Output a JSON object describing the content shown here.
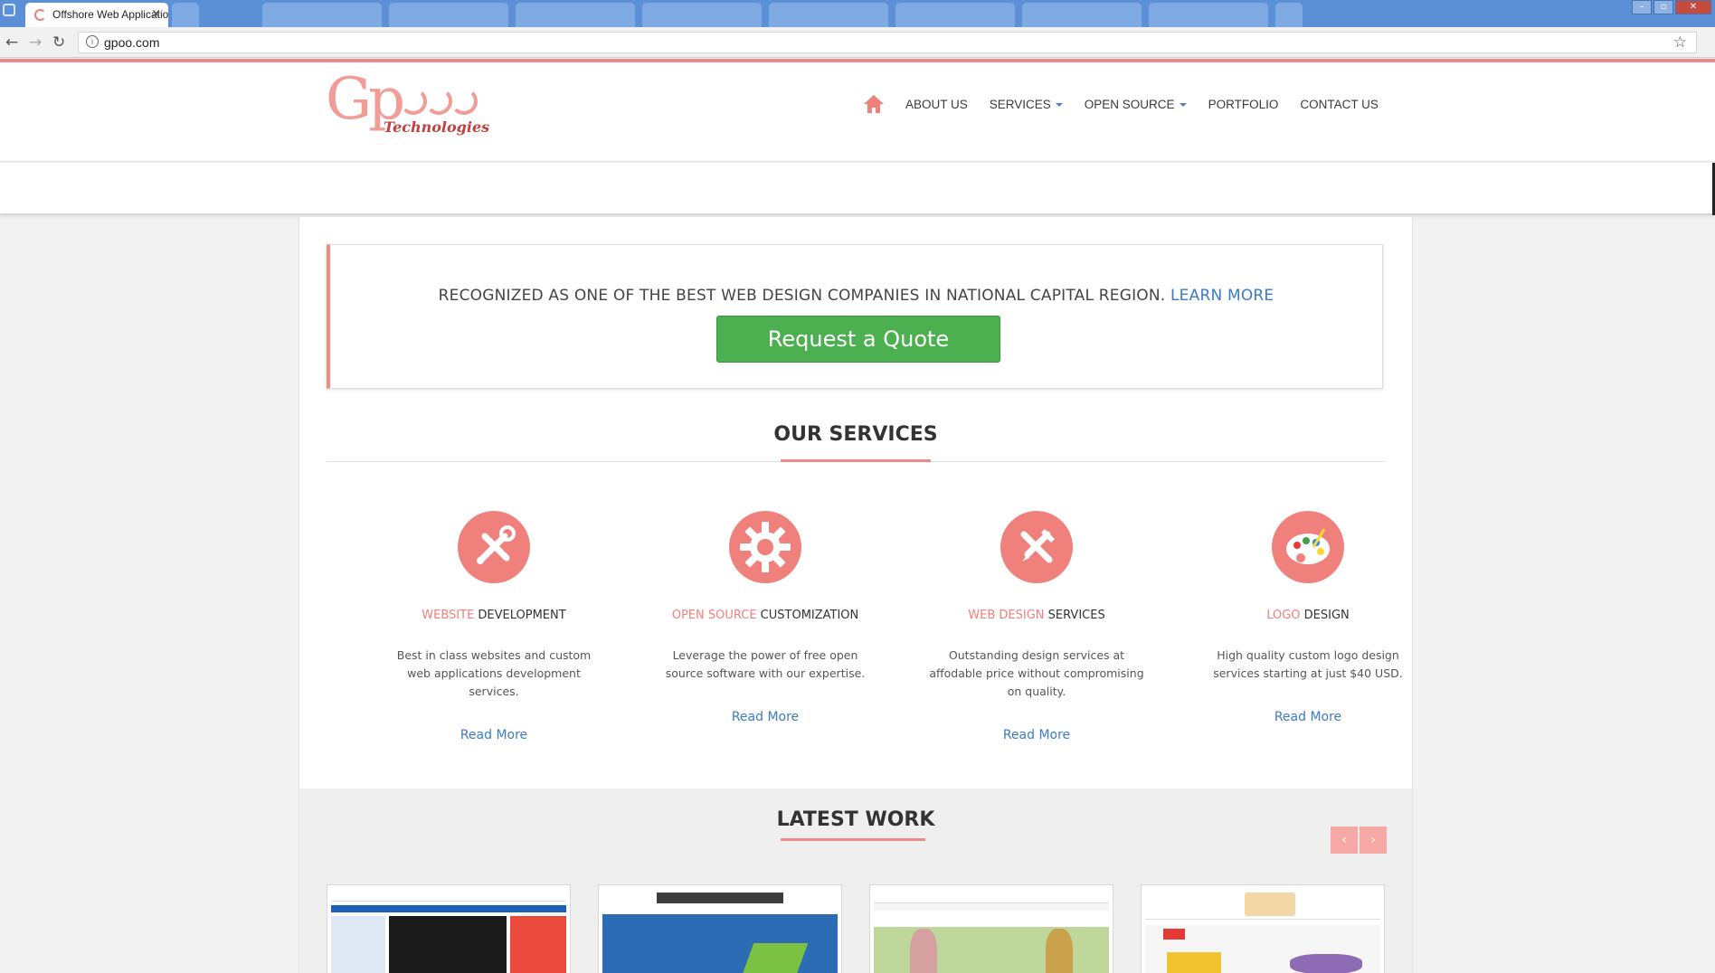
{
  "browser": {
    "active_tab_title": "Offshore Web Applicatio",
    "close_glyph": "×",
    "url": "gpoo.com",
    "info_glyph": "i",
    "back_glyph": "←",
    "forward_glyph": "→",
    "reload_glyph": "↻",
    "star_glyph": "☆",
    "window_minimize": "–",
    "window_restore": "▫",
    "window_close": "✕"
  },
  "header": {
    "logo_letters": "Gp",
    "logo_text": "Technologies",
    "nav": [
      {
        "label": "ABOUT US",
        "has_dropdown": false
      },
      {
        "label": "SERVICES",
        "has_dropdown": true
      },
      {
        "label": "OPEN SOURCE",
        "has_dropdown": true
      },
      {
        "label": "PORTFOLIO",
        "has_dropdown": false
      },
      {
        "label": "CONTACT US",
        "has_dropdown": false
      }
    ]
  },
  "quote": {
    "text": "RECOGNIZED AS ONE OF THE BEST WEB DESIGN COMPANIES IN NATIONAL CAPITAL REGION.",
    "link": "LEARN MORE",
    "button": "Request a Quote"
  },
  "services": {
    "title": "OUR SERVICES",
    "items": [
      {
        "icon": "tools-icon",
        "accent": "WEBSITE",
        "rest": " DEVELOPMENT",
        "desc": "Best in class websites and custom web applications development services.",
        "link": "Read More"
      },
      {
        "icon": "gear-icon",
        "accent": "OPEN SOURCE",
        "rest": " CUSTOMIZATION",
        "desc": "Leverage the power of free open source software with our expertise.",
        "link": "Read More"
      },
      {
        "icon": "pencil-ruler-icon",
        "accent": "WEB DESIGN",
        "rest": " SERVICES",
        "desc": "Outstanding design services at affodable price without compromising on quality.",
        "link": "Read More"
      },
      {
        "icon": "palette-icon",
        "accent": "LOGO",
        "rest": " DESIGN",
        "desc": "High quality custom logo design services starting at just $40 USD.",
        "link": "Read More"
      }
    ]
  },
  "latest_work": {
    "title": "LATEST WORK",
    "prev_glyph": "‹",
    "next_glyph": "›"
  },
  "colors": {
    "accent": "#f0807c",
    "link": "#3b7cc4",
    "button_green": "#4caf50"
  }
}
